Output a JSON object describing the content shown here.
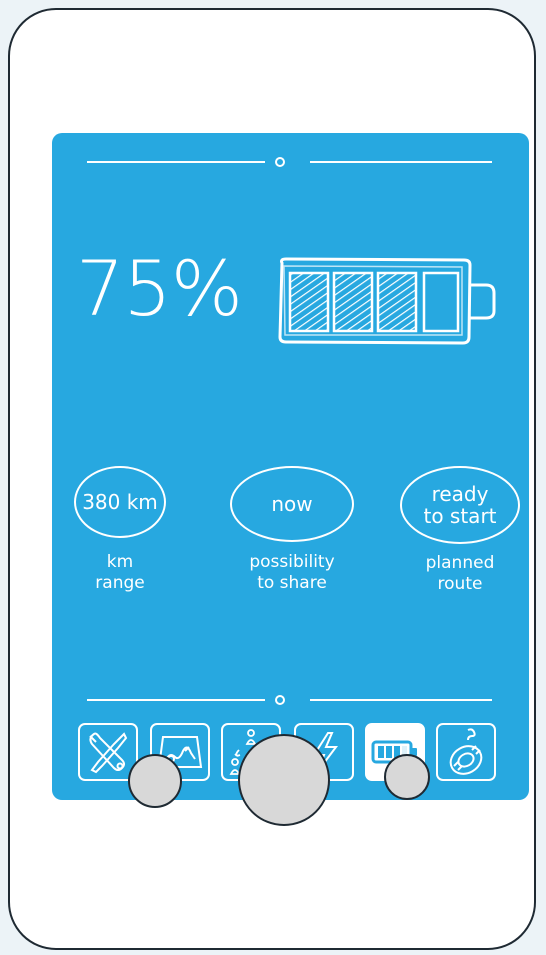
{
  "battery": {
    "percent_text": "75%",
    "level": 0.75
  },
  "stats": [
    {
      "value": "380 km",
      "label_line1": "km",
      "label_line2": "range"
    },
    {
      "value": "now",
      "label_line1": "possibility",
      "label_line2": "to share"
    },
    {
      "value_line1": "ready",
      "value_line2": "to start",
      "label_line1": "planned",
      "label_line2": "route"
    }
  ],
  "toolbar": {
    "items": [
      "tools-icon",
      "map-icon",
      "share-people-icon",
      "lightning-icon",
      "battery-icon",
      "tire-icon"
    ],
    "active": "battery-icon"
  },
  "colors": {
    "screen": "#27a8e0",
    "device": "#ffffff",
    "outline": "#1f2a33",
    "button_fill": "#d8d8d8"
  }
}
